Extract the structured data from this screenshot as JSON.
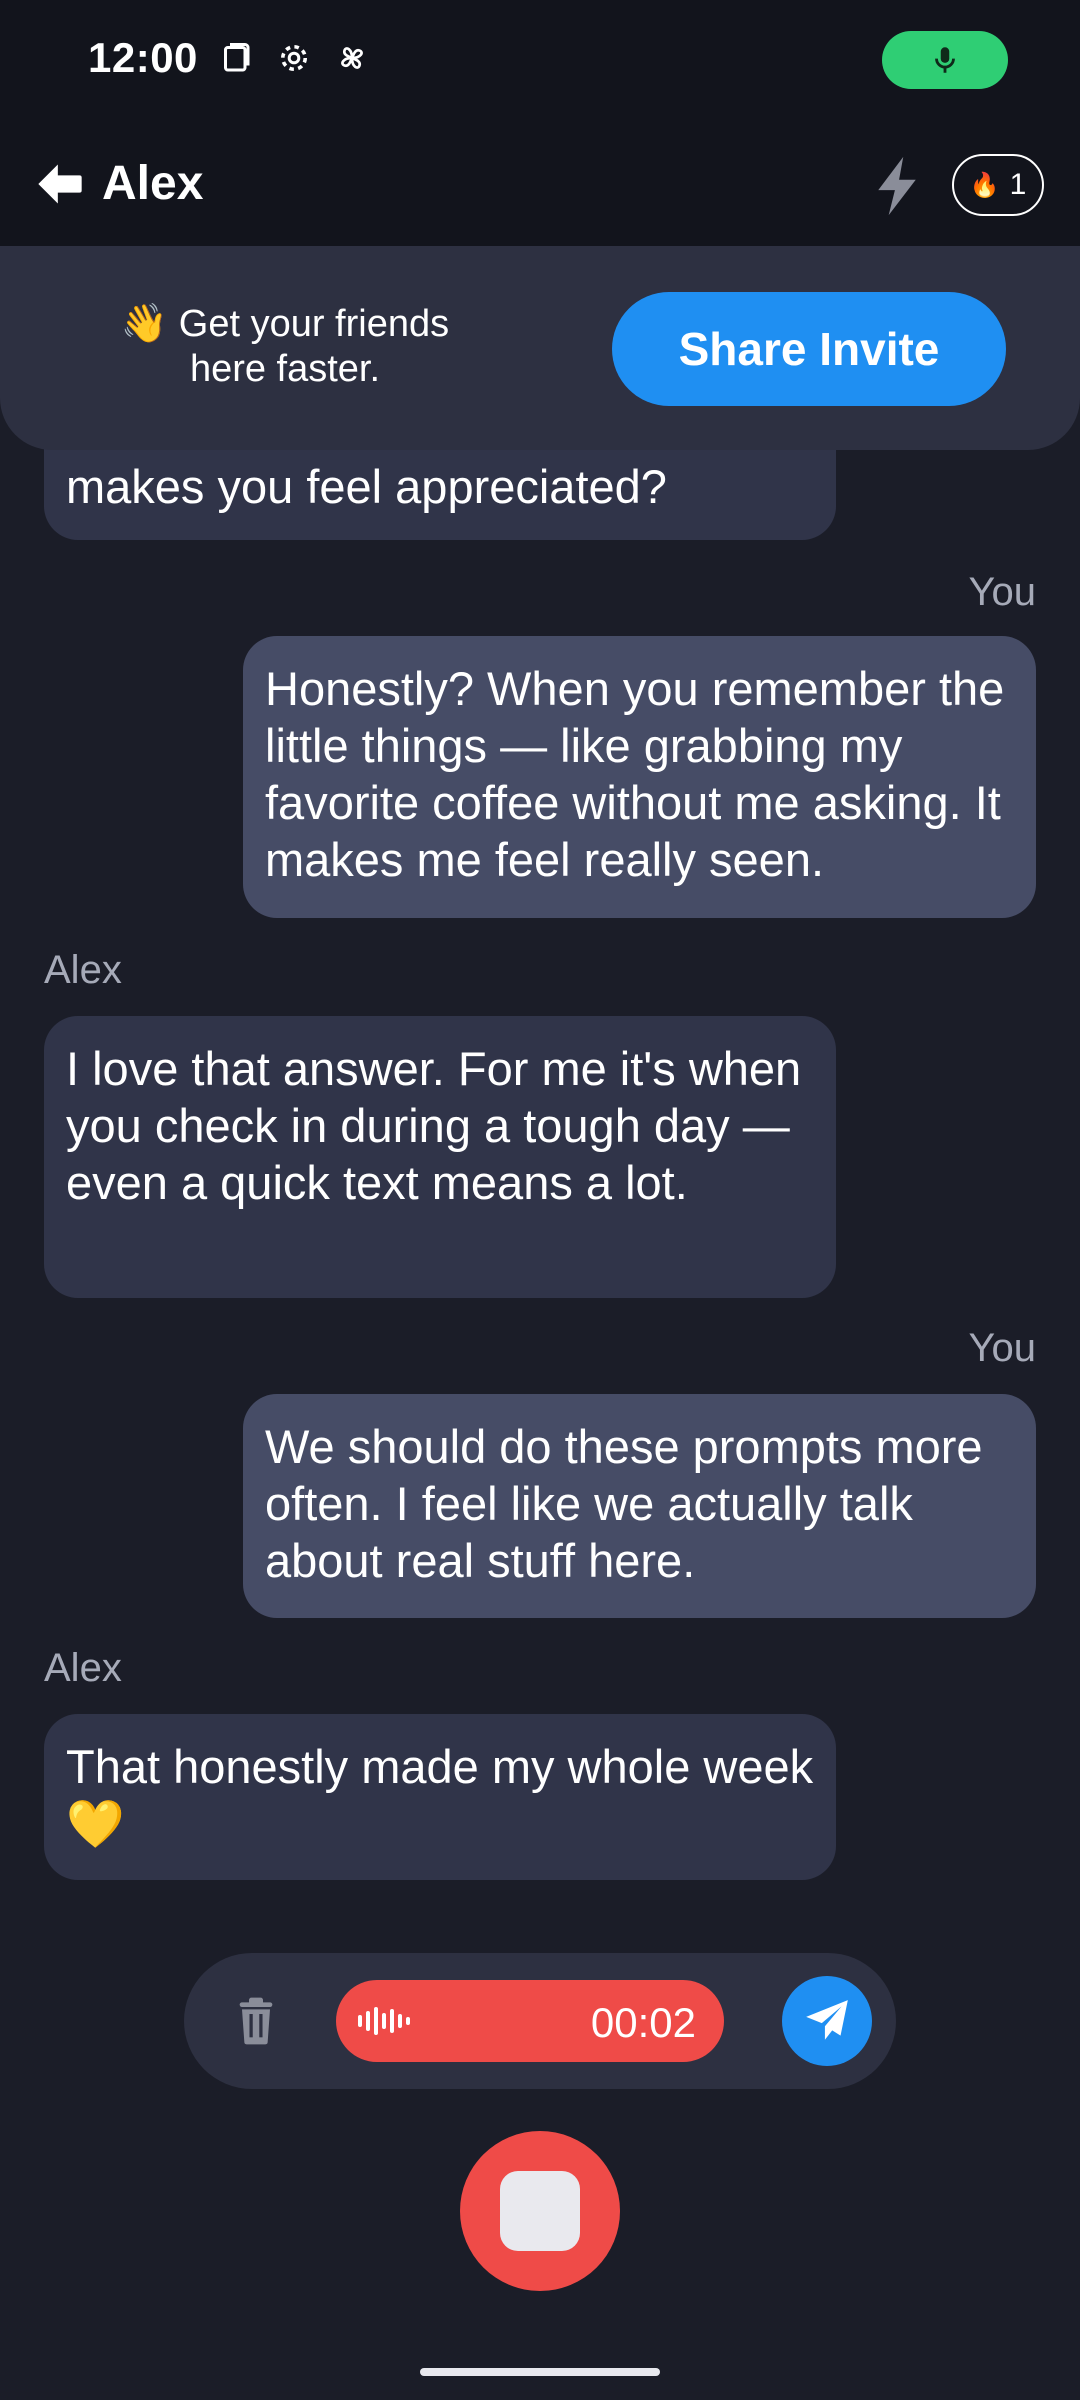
{
  "status_bar": {
    "time": "12:00",
    "icons": [
      "screen-icon",
      "settings-icon",
      "pinwheel-icon"
    ],
    "mic_indicator_color": "#2fce74"
  },
  "header": {
    "title": "Alex",
    "streak_count": "1",
    "streak_icon": "🔥"
  },
  "invite_banner": {
    "text": "👋 Get your friends here faster.",
    "button_label": "Share Invite"
  },
  "messages": [
    {
      "sender": "",
      "text": "makes you feel appreciated?",
      "from": "them"
    },
    {
      "sender": "You",
      "text": "Honestly? When you remember the little things — like grabbing my favorite coffee without me asking. It makes me feel really seen.",
      "from": "me"
    },
    {
      "sender": "Alex",
      "text": "I love that answer. For me it's when you check in during a tough day — even a quick text means a lot.",
      "from": "them"
    },
    {
      "sender": "You",
      "text": "We should do these prompts more often. I feel like we actually talk about real stuff here.",
      "from": "me"
    },
    {
      "sender": "Alex",
      "text": "That honestly made my whole week 💛",
      "from": "them"
    }
  ],
  "recorder": {
    "elapsed": "00:02"
  },
  "colors": {
    "background": "#1b1d28",
    "accent_blue": "#1f8ff2",
    "record_red": "#ef4b48"
  }
}
